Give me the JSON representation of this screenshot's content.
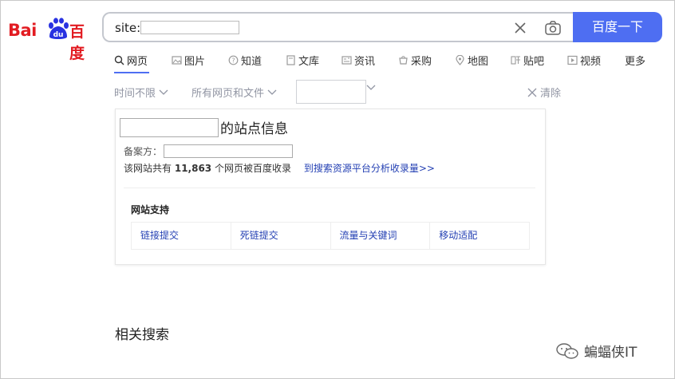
{
  "logo": {
    "text_bai": "Bai",
    "text_du": "du",
    "text_cn": "百度"
  },
  "search": {
    "prefix": "site:",
    "button_label": "百度一下"
  },
  "tabs": [
    {
      "label": "网页",
      "icon": "search-icon",
      "active": true
    },
    {
      "label": "图片",
      "icon": "image-icon"
    },
    {
      "label": "知道",
      "icon": "question-icon"
    },
    {
      "label": "文库",
      "icon": "doc-icon"
    },
    {
      "label": "资讯",
      "icon": "news-icon"
    },
    {
      "label": "采购",
      "icon": "cart-icon"
    },
    {
      "label": "地图",
      "icon": "map-pin-icon"
    },
    {
      "label": "贴吧",
      "icon": "tieba-icon"
    },
    {
      "label": "视频",
      "icon": "video-icon"
    },
    {
      "label": "更多",
      "icon": ""
    }
  ],
  "filters": {
    "time": "时间不限",
    "type": "所有网页和文件",
    "clear": "清除"
  },
  "card": {
    "title_suffix": "的站点信息",
    "icp_label": "备案方：",
    "count_prefix": "该网站共有",
    "count_value": "11,863",
    "count_suffix": "个网页被百度收录",
    "count_link": "到搜索资源平台分析收录量>>",
    "support_title": "网站支持",
    "support_items": [
      "链接提交",
      "死链提交",
      "流量与关键词",
      "移动适配"
    ]
  },
  "related_title": "相关搜索",
  "watermark": "蝙蝠侠IT",
  "colors": {
    "brand_red": "#e21c22",
    "brand_blue": "#4e6ef2",
    "link_blue": "#2440b3"
  }
}
